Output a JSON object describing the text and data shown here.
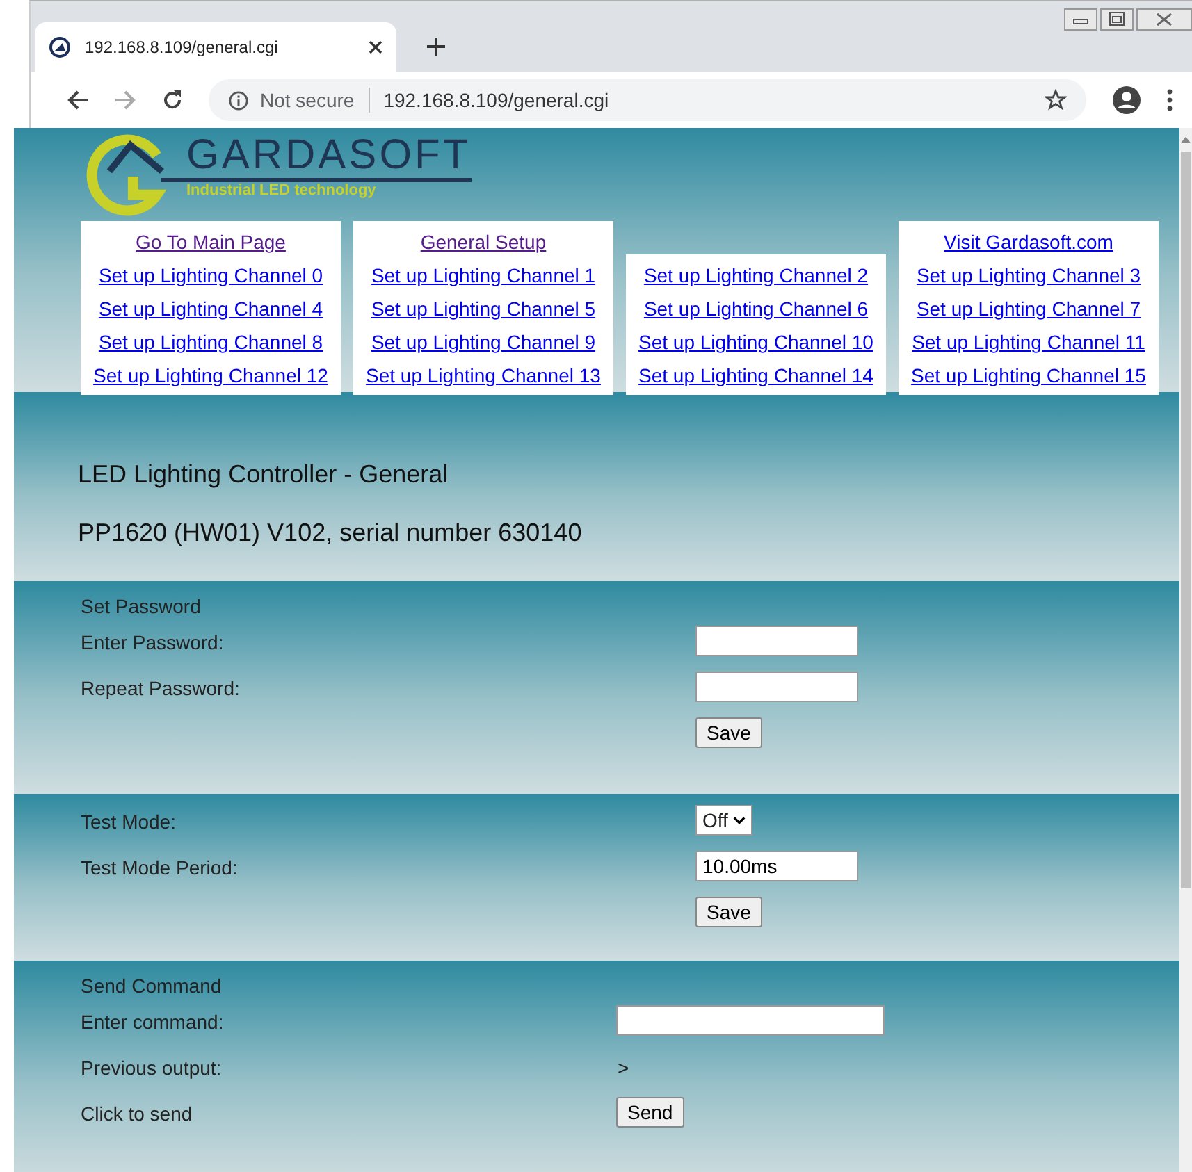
{
  "browser": {
    "tab_title": "192.168.8.109/general.cgi",
    "security": "Not secure",
    "url": "192.168.8.109/general.cgi"
  },
  "logo": {
    "name": "GARDASOFT",
    "tagline": "Industrial LED technology"
  },
  "nav": {
    "columns": [
      {
        "links": [
          {
            "text": "Go To Main Page",
            "visited": true
          },
          {
            "text": "Set up Lighting Channel 0",
            "visited": false
          },
          {
            "text": "Set up Lighting Channel 4",
            "visited": false
          },
          {
            "text": "Set up Lighting Channel 8",
            "visited": false
          },
          {
            "text": "Set up Lighting Channel 12",
            "visited": false
          }
        ]
      },
      {
        "links": [
          {
            "text": "General Setup",
            "visited": true
          },
          {
            "text": "Set up Lighting Channel 1",
            "visited": false
          },
          {
            "text": "Set up Lighting Channel 5",
            "visited": false
          },
          {
            "text": "Set up Lighting Channel 9",
            "visited": false
          },
          {
            "text": "Set up Lighting Channel 13",
            "visited": false
          }
        ]
      },
      {
        "links": [
          {
            "text": "Set up Lighting Channel 2",
            "visited": false
          },
          {
            "text": "Set up Lighting Channel 6",
            "visited": false
          },
          {
            "text": "Set up Lighting Channel 10",
            "visited": false
          },
          {
            "text": "Set up Lighting Channel 14",
            "visited": false
          }
        ]
      },
      {
        "links": [
          {
            "text": "Visit Gardasoft.com",
            "visited": false
          },
          {
            "text": "Set up Lighting Channel 3",
            "visited": false
          },
          {
            "text": "Set up Lighting Channel 7",
            "visited": false
          },
          {
            "text": "Set up Lighting Channel 11",
            "visited": false
          },
          {
            "text": "Set up Lighting Channel 15",
            "visited": false
          }
        ]
      }
    ]
  },
  "heading": {
    "title": "LED Lighting Controller - General",
    "subtitle": "PP1620 (HW01) V102, serial number 630140"
  },
  "sections": [
    {
      "title": "Set Password",
      "rows": [
        {
          "kind": "input",
          "label": "Enter Password:"
        },
        {
          "kind": "input",
          "label": "Repeat Password:"
        },
        {
          "kind": "button",
          "text": "Save"
        }
      ]
    },
    {
      "rows": [
        {
          "kind": "select",
          "label": "Test Mode:",
          "value": "Off"
        },
        {
          "kind": "input",
          "label": "Test Mode Period:",
          "value": "10.00ms"
        },
        {
          "kind": "button",
          "text": "Save"
        }
      ]
    },
    {
      "title": "Send Command",
      "rows": [
        {
          "kind": "input",
          "label": "Enter command:"
        },
        {
          "kind": "output",
          "label": "Previous output:",
          "value": ">"
        },
        {
          "kind": "button",
          "label": "Click to send",
          "text": "Send"
        }
      ]
    }
  ]
}
